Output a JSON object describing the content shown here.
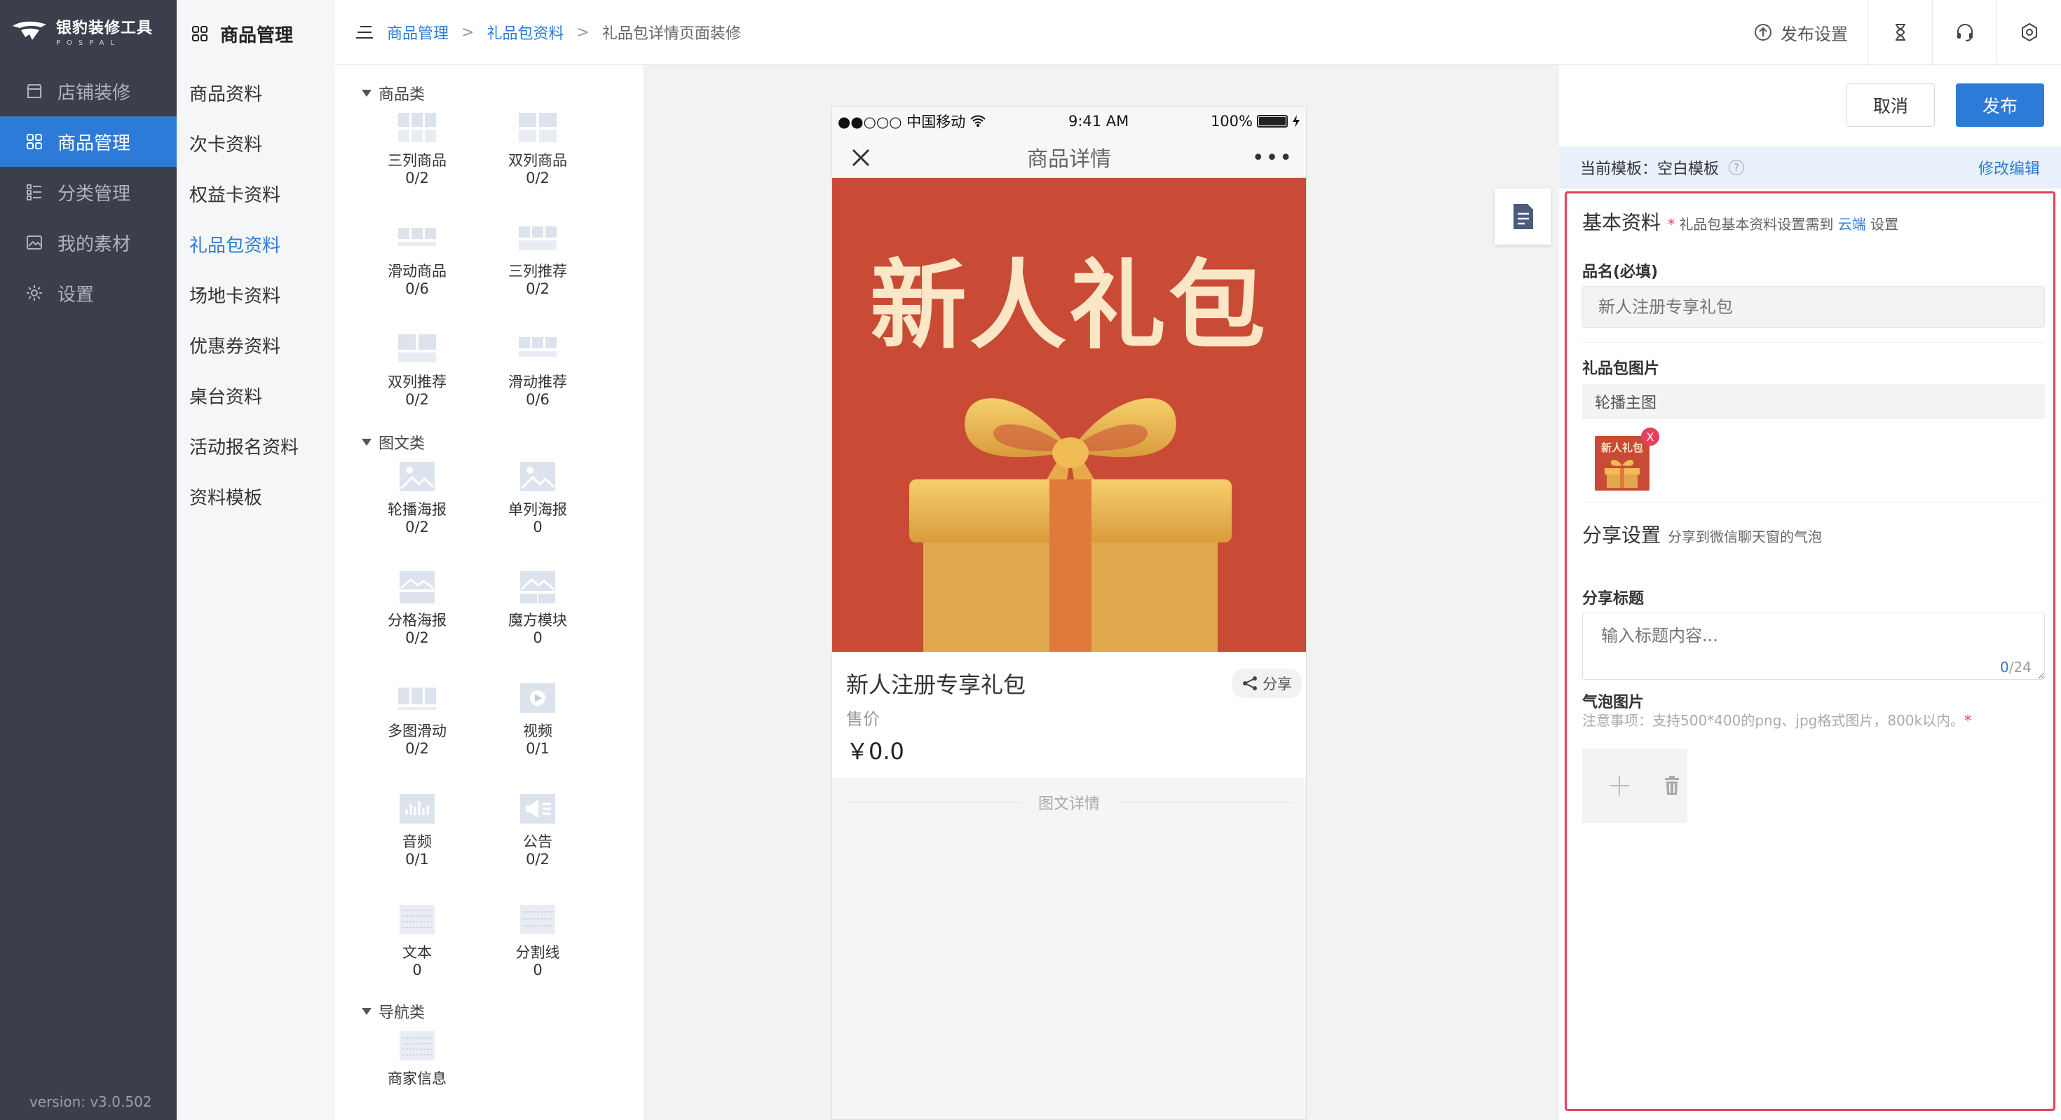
{
  "brand": {
    "title": "银豹装修工具",
    "subtitle": "POSPAL",
    "version": "version: v3.0.502"
  },
  "sidebar": {
    "items": [
      {
        "label": "店铺装修",
        "icon": "store-icon",
        "active": false
      },
      {
        "label": "商品管理",
        "icon": "grid-icon",
        "active": true
      },
      {
        "label": "分类管理",
        "icon": "list-icon",
        "active": false
      },
      {
        "label": "我的素材",
        "icon": "image-icon",
        "active": false
      },
      {
        "label": "设置",
        "icon": "gear-icon",
        "active": false
      }
    ]
  },
  "subnav": {
    "title": "商品管理",
    "items": [
      {
        "label": "商品资料",
        "active": false
      },
      {
        "label": "次卡资料",
        "active": false
      },
      {
        "label": "权益卡资料",
        "active": false
      },
      {
        "label": "礼品包资料",
        "active": true
      },
      {
        "label": "场地卡资料",
        "active": false
      },
      {
        "label": "优惠券资料",
        "active": false
      },
      {
        "label": "桌台资料",
        "active": false
      },
      {
        "label": "活动报名资料",
        "active": false
      },
      {
        "label": "资料模板",
        "active": false
      }
    ]
  },
  "breadcrumb": {
    "first": "商品管理",
    "second": "礼品包资料",
    "current": "礼品包详情页面装修",
    "sep": ">"
  },
  "topbar": {
    "publish_settings": "发布设置"
  },
  "library": {
    "categories": {
      "goods": "商品类",
      "media": "图文类",
      "nav": "导航类"
    },
    "widgets": [
      {
        "name": "三列商品",
        "count": "0/2"
      },
      {
        "name": "双列商品",
        "count": "0/2"
      },
      {
        "name": "滑动商品",
        "count": "0/6"
      },
      {
        "name": "三列推荐",
        "count": "0/2"
      },
      {
        "name": "双列推荐",
        "count": "0/2"
      },
      {
        "name": "滑动推荐",
        "count": "0/6"
      },
      {
        "name": "轮播海报",
        "count": "0/2"
      },
      {
        "name": "单列海报",
        "count": "0"
      },
      {
        "name": "分格海报",
        "count": "0/2"
      },
      {
        "name": "魔方模块",
        "count": "0"
      },
      {
        "name": "多图滑动",
        "count": "0/2"
      },
      {
        "name": "视频",
        "count": "0/1"
      },
      {
        "name": "音频",
        "count": "0/1"
      },
      {
        "name": "公告",
        "count": "0/2"
      },
      {
        "name": "文本",
        "count": "0"
      },
      {
        "name": "分割线",
        "count": "0"
      },
      {
        "name": "商家信息",
        "count": ""
      }
    ]
  },
  "phone": {
    "carrier": "●●○○○ 中国移动",
    "time": "9:41 AM",
    "battery": "100%",
    "battery_level": 1.0,
    "header_title": "商品详情",
    "more": "•••",
    "banner_title": "新人礼包",
    "product_name": "新人注册专享礼包",
    "price_label": "售价",
    "price": "￥0.0",
    "share": "分享",
    "detail_label": "图文详情"
  },
  "panel": {
    "cancel": "取消",
    "publish": "发布",
    "template_label": "当前模板：空白模板",
    "template_help": "?",
    "edit_link": "修改编辑",
    "basic_title": "基本资料",
    "basic_req": "*",
    "basic_hint_pre": "礼品包基本资料设置需到",
    "basic_hint_link": "云端",
    "basic_hint_post": "设置",
    "name_label": "品名(必填)",
    "name_placeholder": "新人注册专享礼包",
    "image_label": "礼品包图片",
    "carousel_label": "轮播主图",
    "thumb_text": "新人礼包",
    "thumb_close": "X",
    "share_title": "分享设置",
    "share_hint": "分享到微信聊天窗的气泡",
    "share_field_label": "分享标题",
    "share_placeholder": "输入标题内容...",
    "counter_current": "0",
    "counter_max": "/24",
    "bubble_label": "气泡图片",
    "bubble_note": "注意事项：支持500*400的png、jpg格式图片，800k以内。",
    "bubble_note_star": "*"
  },
  "colors": {
    "accent": "#2d7bd8",
    "sidebar_bg": "#3a3f4b",
    "highlight_border": "#e6405a",
    "banner_red": "#c94b36"
  }
}
